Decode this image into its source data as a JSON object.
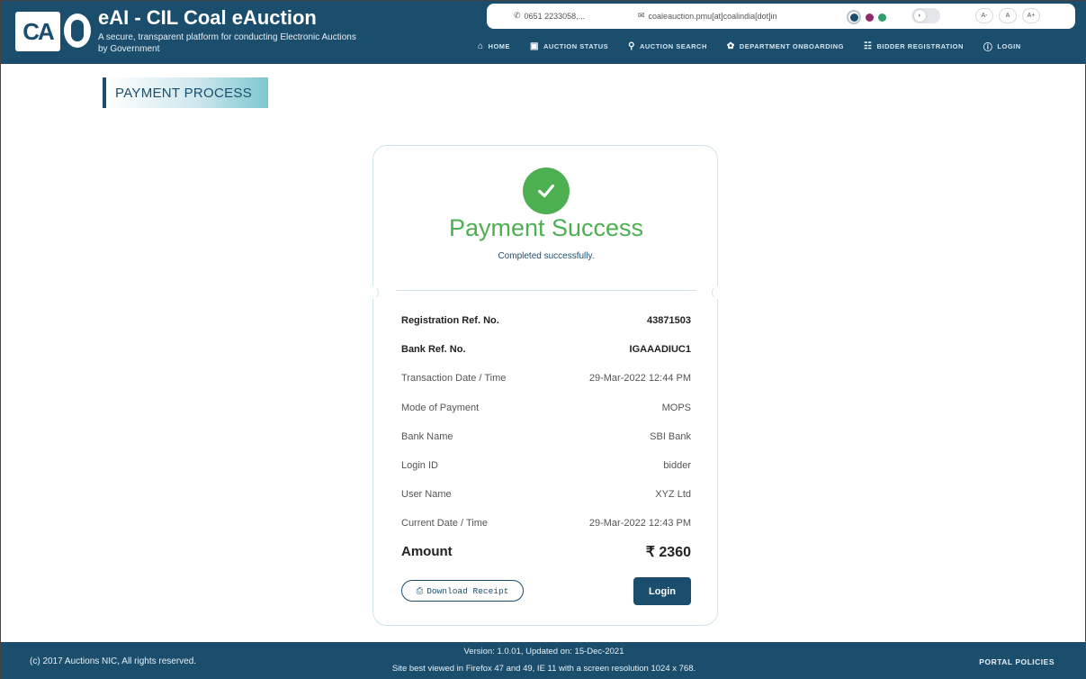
{
  "header": {
    "title": "eAI - CIL Coal eAuction",
    "tagline": "A secure, transparent platform for conducting Electronic Auctions by Government",
    "logo_text": "CA",
    "phone": "0651 2233058,...",
    "email": "coaleauction.pmu[at]coalindia[dot]in",
    "theme_colors": [
      "#1b4e6d",
      "#8e2a6e",
      "#2e9e6a"
    ],
    "font_sizes": [
      "A-",
      "A",
      "A+"
    ],
    "nav": [
      {
        "label": "HOME",
        "icon": "home-icon"
      },
      {
        "label": "AUCTION STATUS",
        "icon": "document-icon"
      },
      {
        "label": "AUCTION SEARCH",
        "icon": "search-icon"
      },
      {
        "label": "DEPARTMENT ONBOARDING",
        "icon": "leaf-icon"
      },
      {
        "label": "BIDDER REGISTRATION",
        "icon": "id-card-icon"
      },
      {
        "label": "LOGIN",
        "icon": "login-icon"
      }
    ]
  },
  "page": {
    "title": "PAYMENT PROCESS"
  },
  "payment": {
    "status_title": "Payment Success",
    "status_subtitle": "Completed successfully.",
    "rows": [
      {
        "label": "Registration Ref. No.",
        "value": "43871503",
        "bold": true
      },
      {
        "label": "Bank Ref. No.",
        "value": "IGAAADIUC1",
        "bold": true
      },
      {
        "label": "Transaction Date / Time",
        "value": "29-Mar-2022 12:44 PM",
        "bold": false
      },
      {
        "label": "Mode of Payment",
        "value": "MOPS",
        "bold": false
      },
      {
        "label": "Bank Name",
        "value": "SBI Bank",
        "bold": false
      },
      {
        "label": "Login ID",
        "value": "bidder",
        "bold": false
      },
      {
        "label": "User Name",
        "value": "XYZ Ltd",
        "bold": false
      },
      {
        "label": "Current Date / Time",
        "value": "29-Mar-2022 12:43 PM",
        "bold": false
      }
    ],
    "amount_label": "Amount",
    "amount_value": "₹ 2360",
    "download_label": "Download Receipt",
    "login_label": "Login"
  },
  "footer": {
    "copyright": "(c) 2017 Auctions NIC, All rights reserved.",
    "version": "Version: 1.0.01, Updated on: 15-Dec-2021",
    "best_viewed": "Site best viewed in Firefox 47 and 49, IE 11 with a screen resolution 1024 x 768.",
    "policies": "PORTAL POLICIES"
  }
}
